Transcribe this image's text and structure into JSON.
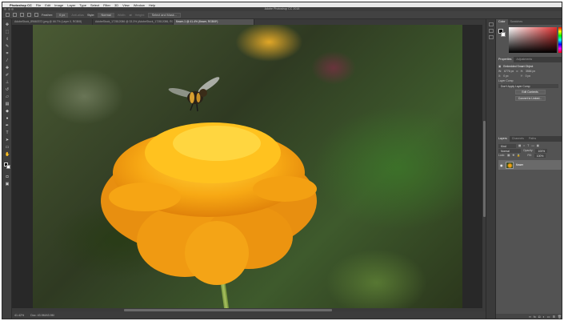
{
  "menubar": {
    "app_name": "Photoshop CC",
    "items": [
      "File",
      "Edit",
      "Image",
      "Layer",
      "Type",
      "Select",
      "Filter",
      "3D",
      "View",
      "Window",
      "Help"
    ]
  },
  "window": {
    "title": "Adobe Photoshop CC 2018"
  },
  "options": {
    "feather_label": "Feather:",
    "feather_value": "0 px",
    "antialias_label": "Anti-alias",
    "style_label": "Style:",
    "style_value": "Normal",
    "width_label": "Width:",
    "height_label": "Height:",
    "select_mask_label": "Select and Mask..."
  },
  "tabs": [
    {
      "label": "AdobeStock_89660372.jpeg @ 66.7% (Layer 0, RGB/8)"
    },
    {
      "label": "AdobeStock_172812086 @ 33.3% (AdobeStock_172812086, RGB/8)"
    },
    {
      "label": "flower-1 @ 41.4% (flower, RGB/8*)"
    }
  ],
  "status": {
    "zoom": "41.42%",
    "doc": "Doc: 43.9M/43.9M"
  },
  "panels": {
    "color_tabs": [
      "Color",
      "Swatches"
    ],
    "props_tabs": [
      "Properties",
      "Adjustments"
    ],
    "props_title": "Embedded Smart Object",
    "w_label": "W:",
    "w_value": "6776 px",
    "h_label": "H:",
    "h_value": "3584 px",
    "x_label": "X:",
    "x_value": "0 px",
    "y_label": "Y:",
    "y_value": "0 px",
    "layer_comp_label": "Layer Comp",
    "layer_comp_value": "Don't Apply Layer Comp",
    "edit_contents": "Edit Contents",
    "convert_linked": "Convert to Linked...",
    "layers_tabs": [
      "Layers",
      "Channels",
      "Paths"
    ],
    "kind_label": "Kind",
    "blend_mode": "Normal",
    "opacity_label": "Opacity:",
    "opacity_value": "100%",
    "lock_label": "Lock:",
    "fill_label": "Fill:",
    "fill_value": "100%",
    "layer_name": "flower"
  }
}
